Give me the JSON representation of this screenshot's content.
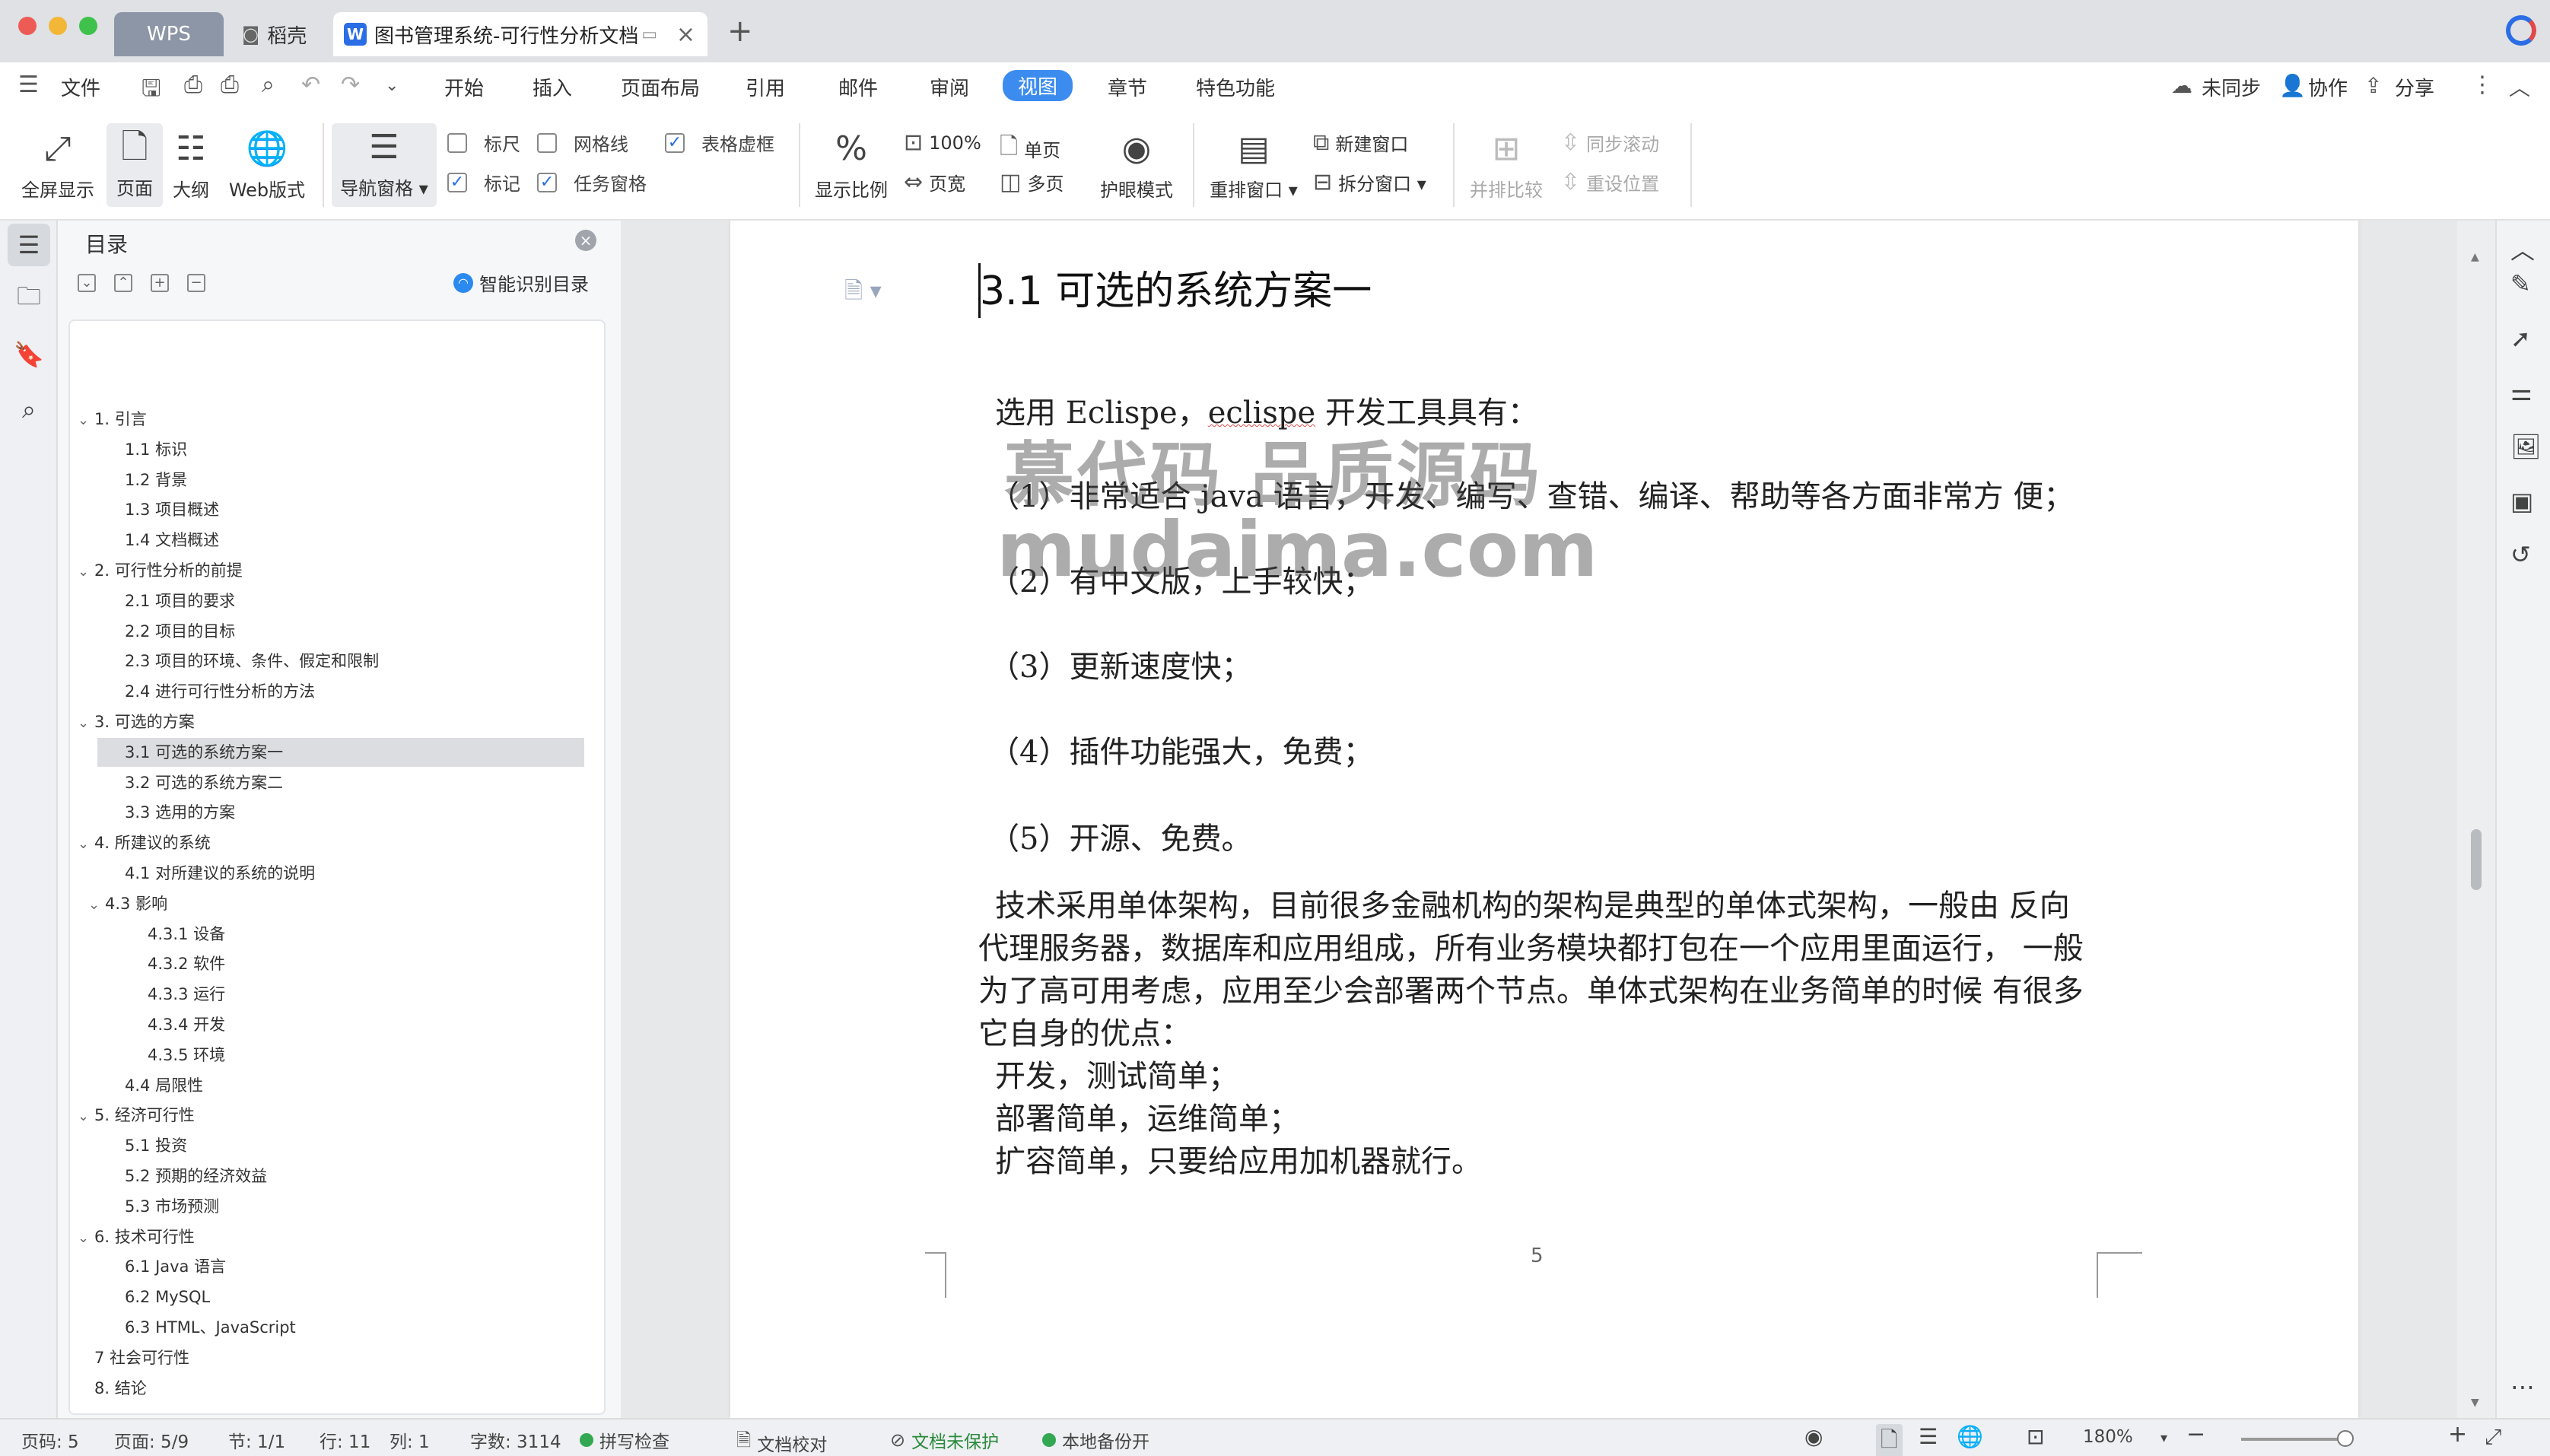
{
  "titlebar": {
    "tabs": [
      {
        "label": "WPS"
      },
      {
        "label": "稻壳"
      },
      {
        "label": "图书管理系统-可行性分析文档"
      }
    ]
  },
  "menu": {
    "file": "文件",
    "tabs": [
      "开始",
      "插入",
      "页面布局",
      "引用",
      "邮件",
      "审阅",
      "视图",
      "章节",
      "特色功能"
    ],
    "active_tab": "视图",
    "sync": "未同步",
    "collab": "协作",
    "share": "分享"
  },
  "ribbon": {
    "fullscreen": "全屏显示",
    "page": "页面",
    "outline": "大纲",
    "web": "Web版式",
    "nav_pane": "导航窗格",
    "ruler": "标尺",
    "gridlines": "网格线",
    "table_gridlines": "表格虚框",
    "marks": "标记",
    "task_pane": "任务窗格",
    "zoom_ratio": "显示比例",
    "hundred": "100%",
    "page_width": "页宽",
    "single_page": "单页",
    "multi_page": "多页",
    "eye_care": "护眼模式",
    "rearrange": "重排窗口",
    "new_window": "新建窗口",
    "split_window": "拆分窗口",
    "side_by_side": "并排比较",
    "sync_scroll": "同步滚动",
    "reset_position": "重设位置"
  },
  "nav": {
    "title": "目录",
    "smart_toc": "智能识别目录",
    "items": [
      {
        "label": "1. 引言",
        "level": 0,
        "caret": true
      },
      {
        "label": "1.1  标识",
        "level": 1
      },
      {
        "label": "1.2  背景",
        "level": 1
      },
      {
        "label": "1.3  项目概述",
        "level": 1
      },
      {
        "label": "1.4  文档概述",
        "level": 1
      },
      {
        "label": "2. 可行性分析的前提",
        "level": 0,
        "caret": true
      },
      {
        "label": "2.1  项目的要求",
        "level": 1
      },
      {
        "label": "2.2  项目的目标",
        "level": 1
      },
      {
        "label": "2.3  项目的环境、条件、假定和限制",
        "level": 1
      },
      {
        "label": "2.4  进行可行性分析的方法",
        "level": 1
      },
      {
        "label": "3. 可选的方案",
        "level": 0,
        "caret": true
      },
      {
        "label": "3.1  可选的系统方案一",
        "level": 1,
        "selected": true
      },
      {
        "label": "3.2  可选的系统方案二",
        "level": 1
      },
      {
        "label": "3.3  选用的方案",
        "level": 1
      },
      {
        "label": "4. 所建议的系统",
        "level": 0,
        "caret": true
      },
      {
        "label": "4.1  对所建议的系统的说明",
        "level": 1
      },
      {
        "label": "4.3  影响",
        "level": 1,
        "caret": true
      },
      {
        "label": "4.3.1  设备",
        "level": 2
      },
      {
        "label": "4.3.2  软件",
        "level": 2
      },
      {
        "label": "4.3.3  运行",
        "level": 2
      },
      {
        "label": "4.3.4  开发",
        "level": 2
      },
      {
        "label": "4.3.5  环境",
        "level": 2
      },
      {
        "label": "4.4  局限性",
        "level": 1
      },
      {
        "label": "5. 经济可行性",
        "level": 0,
        "caret": true
      },
      {
        "label": "5.1  投资",
        "level": 1
      },
      {
        "label": "5.2  预期的经济效益",
        "level": 1
      },
      {
        "label": "5.3  市场预测",
        "level": 1
      },
      {
        "label": "6. 技术可行性",
        "level": 0,
        "caret": true
      },
      {
        "label": "6.1 Java 语言",
        "level": 1
      },
      {
        "label": "6.2 MySQL",
        "level": 1
      },
      {
        "label": "6.3 HTML、JavaScript",
        "level": 1
      },
      {
        "label": "7 社会可行性",
        "level": 0
      },
      {
        "label": "8. 结论",
        "level": 0
      }
    ]
  },
  "document": {
    "heading": "3.1  可选的系统方案一",
    "intro_prefix": "选用 Eclispe，",
    "intro_word": "eclispe",
    "intro_suffix": " 开发工具具有：",
    "features": [
      "（1）非常适合 java 语言，开发、编写、查错、编译、帮助等各方面非常方 便；",
      "（2）有中文版，上手较快；",
      "（3）更新速度快；",
      "（4）插件功能强大，免费；",
      "（5）开源、免费。"
    ],
    "body_lines": [
      "技术采用单体架构，目前很多金融机构的架构是典型的单体式架构，一般由 反向",
      "代理服务器，数据库和应用组成，所有业务模块都打包在一个应用里面运行，  一般",
      "为了高可用考虑，应用至少会部署两个节点。单体式架构在业务简单的时候 有很多",
      "它自身的优点：",
      "开发，测试简单；",
      "部署简单，运维简单；",
      "扩容简单，只要给应用加机器就行。"
    ],
    "watermark_cn": "慕代码 品质源码",
    "watermark_en": "mudaima.com",
    "page_number": "5"
  },
  "status": {
    "page_code": "页码: 5",
    "pages": "页面: 5/9",
    "section": "节: 1/1",
    "row": "行: 11",
    "col": "列: 1",
    "word_count": "字数: 3114",
    "spell_check": "拼写检查",
    "proofread": "文档校对",
    "unprotected": "文档未保护",
    "local_backup": "本地备份开",
    "zoom": "180%"
  }
}
